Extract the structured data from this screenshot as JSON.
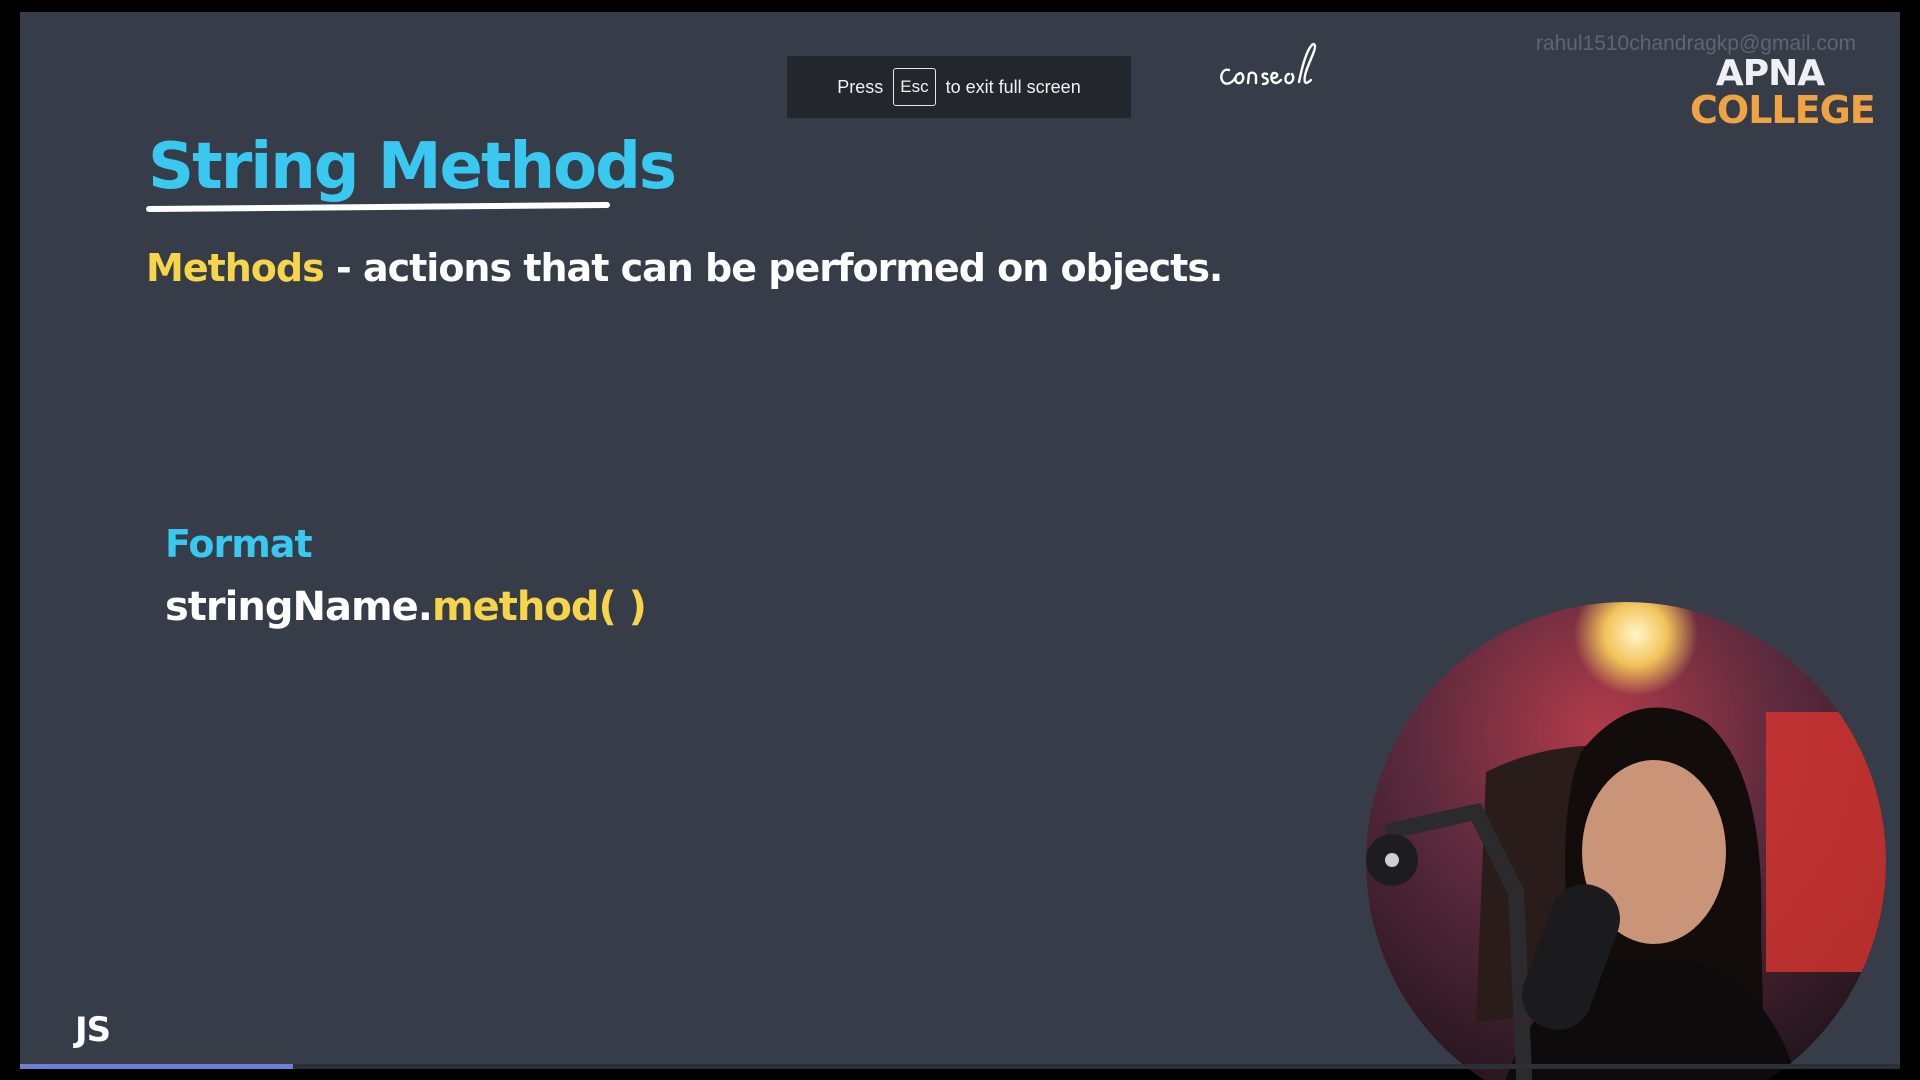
{
  "watermark": "rahul1510chandragkp@gmail.com",
  "logo": {
    "line1": "APNA",
    "line2": "COLLEGE"
  },
  "fullscreen_notice": {
    "before": "Press",
    "key": "Esc",
    "after": "to exit full screen"
  },
  "handwriting": "console",
  "slide": {
    "title": "String Methods",
    "definition": {
      "keyword": "Methods",
      "text": " - actions that can be performed on objects."
    },
    "format_label": "Format",
    "format_code": {
      "object": "stringName.",
      "method": "method( )"
    },
    "footer_label": "JS"
  },
  "video": {
    "progress_fraction": 0.145
  },
  "colors": {
    "slide_bg": "#363d48",
    "title_cyan": "#39c8ef",
    "keyword_yellow": "#f7d54a",
    "logo_orange": "#f0a343",
    "progress": "#6f7fd8"
  }
}
